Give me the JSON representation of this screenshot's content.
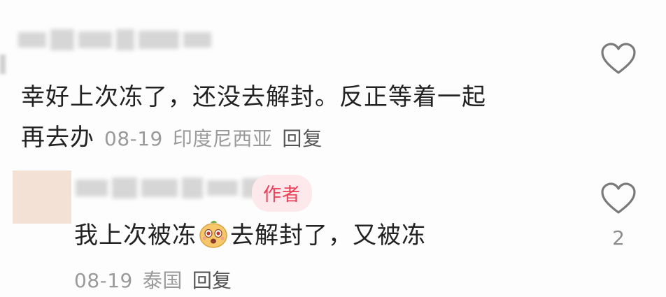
{
  "comments": [
    {
      "text": "幸好上次冻了，还没去解封。反正等着一起再去办",
      "text_line1": "幸好上次冻了，还没去解封。反正等着一起",
      "text_line2": "再去办",
      "date": "08-19",
      "location": "印度尼西亚",
      "reply_label": "回复",
      "like_icon": "heart-outline-icon"
    },
    {
      "author_badge": "作者",
      "text_before_emoji": "我上次被冻",
      "emoji": "surprised-face-emoji",
      "text_after_emoji": "去解封了，又被冻",
      "date": "08-19",
      "location": "泰国",
      "reply_label": "回复",
      "like_icon": "heart-outline-icon",
      "like_count": "2"
    }
  ],
  "colors": {
    "text": "#222222",
    "meta": "#9a9a9a",
    "badge_bg": "#fde9ec",
    "badge_text": "#ea4159",
    "avatar": "#f2e1d4"
  }
}
